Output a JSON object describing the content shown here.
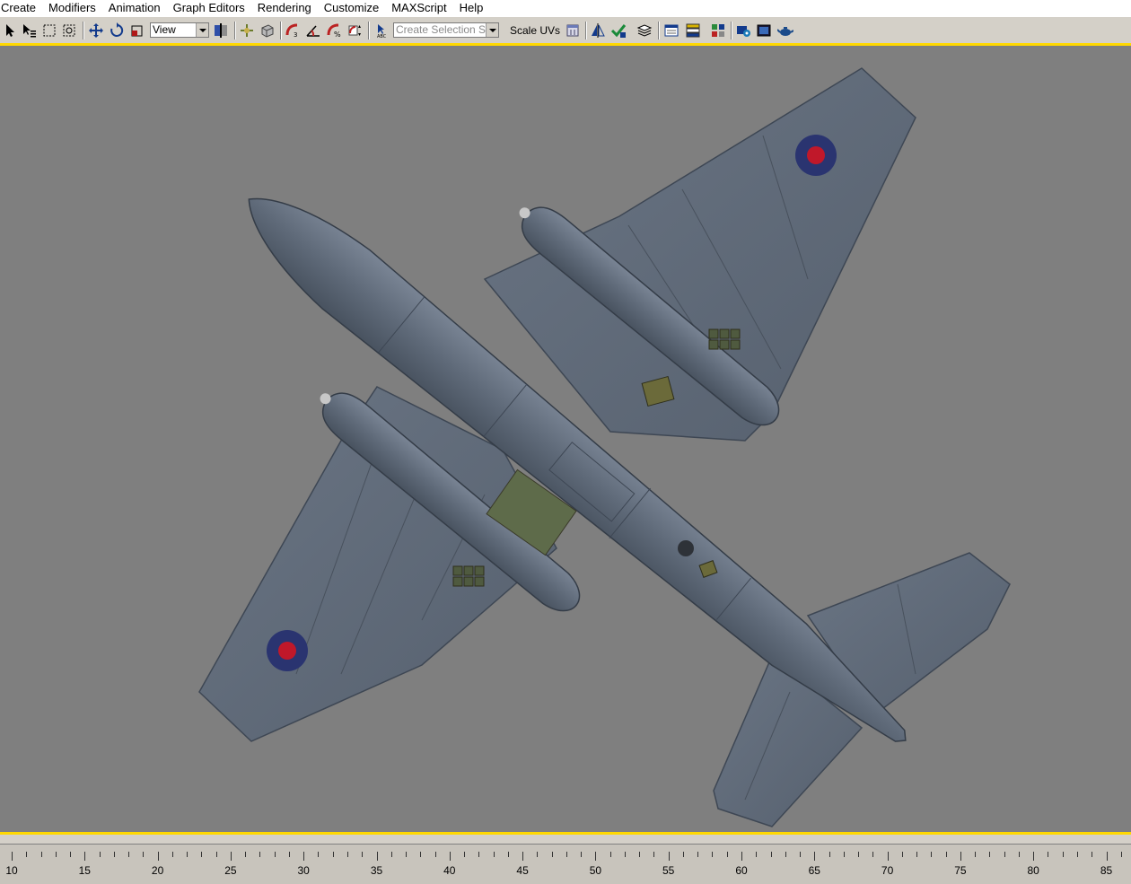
{
  "menu": [
    "Create",
    "Modifiers",
    "Animation",
    "Graph Editors",
    "Rendering",
    "Customize",
    "MAXScript",
    "Help"
  ],
  "toolbar": {
    "reference_coord_system": "View",
    "named_selection_set_placeholder": "Create Selection Set",
    "scale_uvs_label": "Scale UVs",
    "icons": [
      "select-arrow-icon",
      "select-by-name-icon",
      "rect-selection-icon",
      "window-crossing-icon",
      "move-icon",
      "rotate-icon",
      "scale-icon",
      "pivot-center-icon",
      "select-manipulate-icon",
      "keyboard-shortcut-icon",
      "snap-3d-icon",
      "angle-snap-icon",
      "percent-snap-icon",
      "spinner-snap-icon",
      "edit-named-selection-icon",
      "mirror-icon",
      "align-icon",
      "layer-manager-icon",
      "curve-editor-icon",
      "schematic-view-icon",
      "material-editor-icon",
      "render-setup-icon",
      "rendered-frame-icon",
      "quick-render-teapot-icon"
    ]
  },
  "viewport": {
    "background": "#7f7f7f",
    "aircraft_color": "#5d6877",
    "roundel_outer": "#2a3470",
    "roundel_inner": "#c0182a",
    "hatch_color": "#6b6a3a"
  },
  "timeline": {
    "ticks": [
      "10",
      "15",
      "20",
      "25",
      "30",
      "35",
      "40",
      "45",
      "50",
      "55",
      "60",
      "65",
      "70",
      "75",
      "80",
      "85"
    ]
  }
}
